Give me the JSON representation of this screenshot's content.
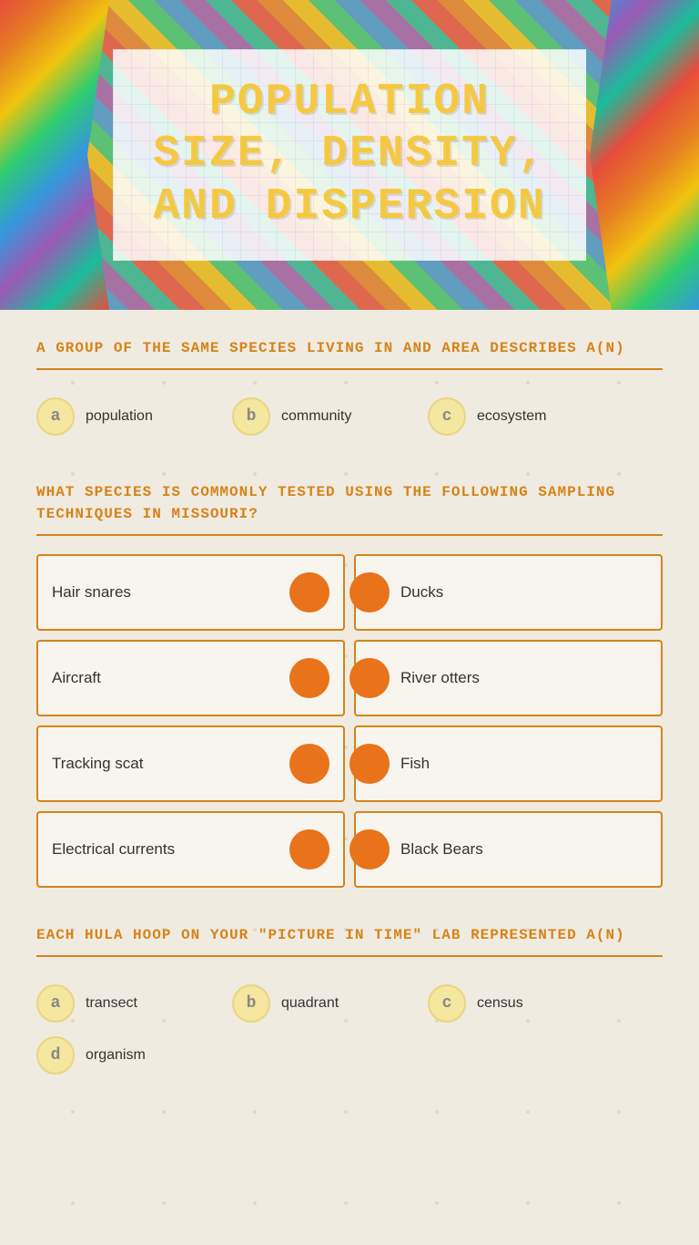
{
  "header": {
    "title": "Population Size, Density, and Dispersion"
  },
  "question1": {
    "text": "A group of the same species living in and area describes a(n)",
    "options": [
      {
        "letter": "a",
        "label": "population"
      },
      {
        "letter": "b",
        "label": "community"
      },
      {
        "letter": "c",
        "label": "ecosystem"
      }
    ]
  },
  "question2": {
    "text": "What species is commonly tested using the following sampling techniques in Missouri?",
    "items_left": [
      {
        "label": "Hair snares"
      },
      {
        "label": "Aircraft"
      },
      {
        "label": "Tracking scat"
      },
      {
        "label": "Electrical currents"
      }
    ],
    "items_right": [
      {
        "label": "Ducks"
      },
      {
        "label": "River otters"
      },
      {
        "label": "Fish"
      },
      {
        "label": "Black Bears"
      }
    ]
  },
  "question3": {
    "text": "Each hula hoop on your \"Picture in Time\" lab represented a(n)",
    "options": [
      {
        "letter": "a",
        "label": "transect"
      },
      {
        "letter": "b",
        "label": "quadrant"
      },
      {
        "letter": "c",
        "label": "census"
      },
      {
        "letter": "d",
        "label": "organism"
      }
    ]
  },
  "colors": {
    "accent": "#d4831a",
    "orange_circle": "#e8731a",
    "badge_bg": "#f5e6a0",
    "title_color": "#f5c842"
  }
}
